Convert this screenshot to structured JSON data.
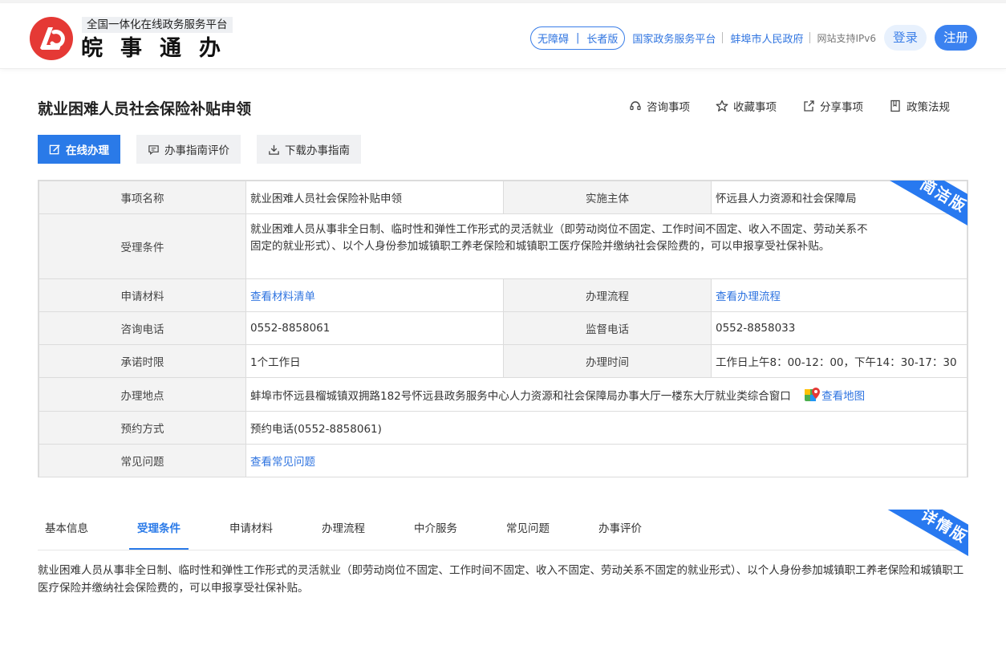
{
  "header": {
    "platform_subtitle": "全国一体化在线政务服务平台",
    "brand_name": "皖事通办",
    "accessibility": {
      "barrier_free": "无障碍",
      "elder_mode": "长者版"
    },
    "links": [
      "国家政务服务平台",
      "蚌埠市人民政府"
    ],
    "ipv6": "网站支持IPv6",
    "login": "登录",
    "register": "注册",
    "brand_color": "#e53935",
    "accent_color": "#2a7ae8"
  },
  "page": {
    "title": "就业困难人员社会保险补贴申领",
    "title_actions": [
      {
        "label": "咨询事项",
        "icon": "headset-icon"
      },
      {
        "label": "收藏事项",
        "icon": "star-icon"
      },
      {
        "label": "分享事项",
        "icon": "share-icon"
      },
      {
        "label": "政策法规",
        "icon": "book-icon"
      }
    ],
    "buttons": [
      {
        "label": "在线办理",
        "icon": "edit-icon"
      },
      {
        "label": "办事指南评价",
        "icon": "comment-icon"
      },
      {
        "label": "下载办事指南",
        "icon": "download-icon"
      }
    ]
  },
  "info": {
    "ribbon": "简洁版",
    "item_name_label": "事项名称",
    "item_name": "就业困难人员社会保险补贴申领",
    "authority_label": "实施主体",
    "authority": "怀远县人力资源和社会保障局",
    "conditions_label": "受理条件",
    "conditions": "就业困难人员从事非全日制、临时性和弹性工作形式的灵活就业（即劳动岗位不固定、工作时间不固定、收入不固定、劳动关系不固定的就业形式）、以个人身份参加城镇职工养老保险和城镇职工医疗保险并缴纳社会保险费的，可以申报享受社保补贴。",
    "materials_label": "申请材料",
    "materials_link": "查看材料清单",
    "process_label": "办理流程",
    "process_link": "查看办理流程",
    "phone_label": "咨询电话",
    "phone": "0552-8858061",
    "supervise_label": "监督电话",
    "supervise": "0552-8858033",
    "promise_label": "承诺时限",
    "promise": "1个工作日",
    "hours_label": "办理时间",
    "hours": "工作日上午8：00-12：00，下午14：30-17：30",
    "address_label": "办理地点",
    "address": "蚌埠市怀远县榴城镇双拥路182号怀远县政务服务中心人力资源和社会保障局办事大厅一楼东大厅就业类综合窗口",
    "map_link": "查看地图",
    "booking_label": "预约方式",
    "booking": "预约电话(0552-8858061)",
    "faq_label": "常见问题",
    "faq_link": "查看常见问题"
  },
  "detail": {
    "ribbon": "详情版",
    "tabs": [
      "基本信息",
      "受理条件",
      "申请材料",
      "办理流程",
      "中介服务",
      "常见问题",
      "办事评价"
    ],
    "active_tab": "受理条件",
    "content": "就业困难人员从事非全日制、临时性和弹性工作形式的灵活就业（即劳动岗位不固定、工作时间不固定、收入不固定、劳动关系不固定的就业形式）、以个人身份参加城镇职工养老保险和城镇职工医疗保险并缴纳社会保险费的，可以申报享受社保补贴。"
  }
}
